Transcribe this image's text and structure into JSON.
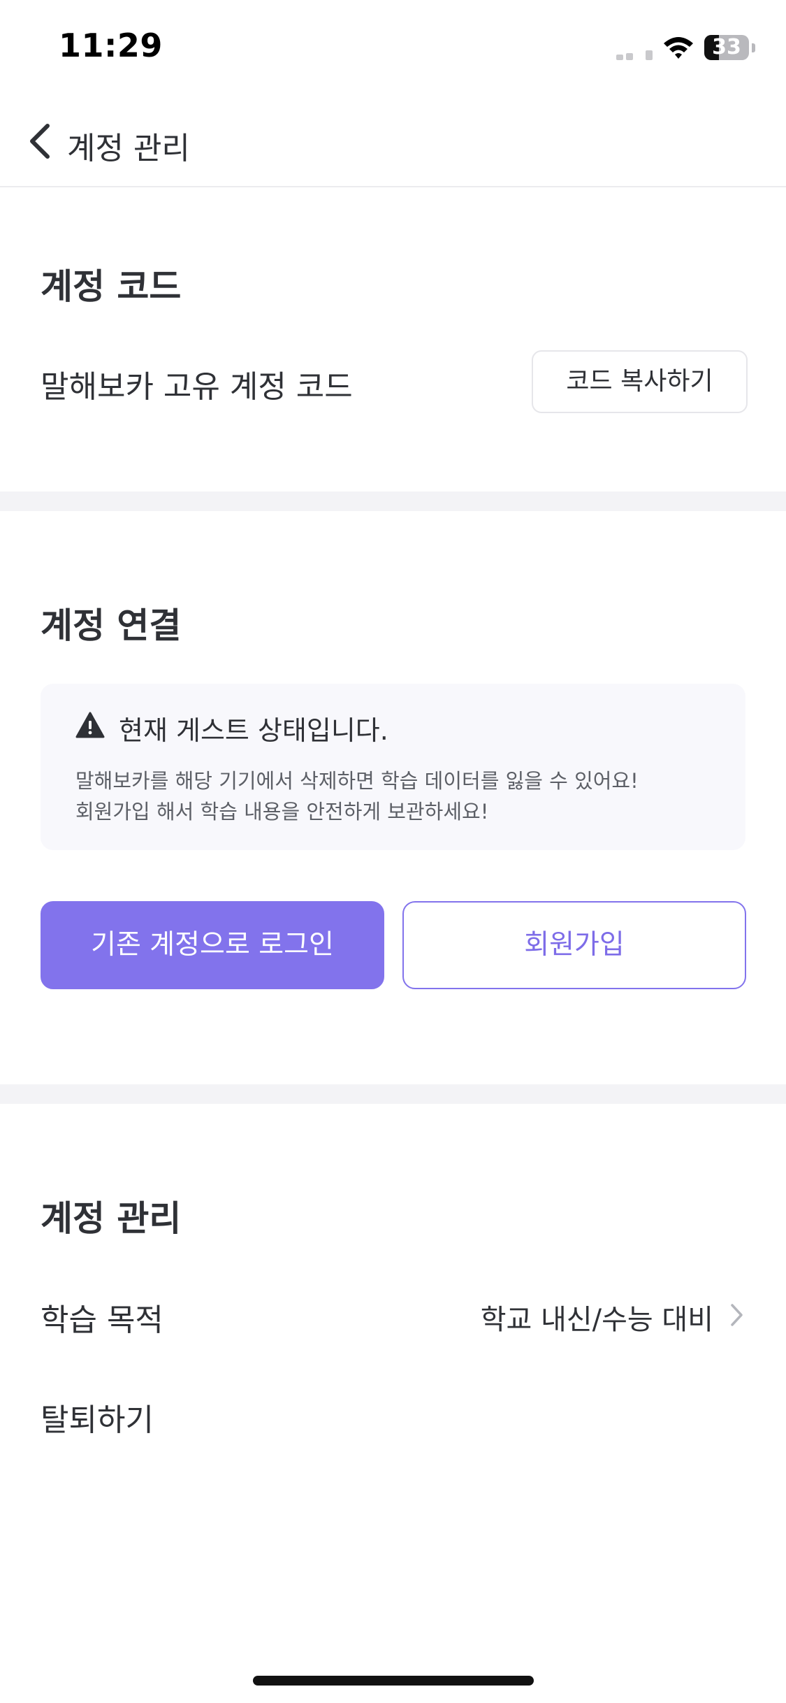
{
  "status_bar": {
    "time": "11:29",
    "battery_percent": "33",
    "battery_level": 0.33,
    "signal_icon": "cellular-signal-icon",
    "wifi_icon": "wifi-icon",
    "battery_icon": "battery-icon"
  },
  "header": {
    "title": "계정 관리",
    "back_icon": "chevron-left-icon"
  },
  "account_code": {
    "section_title": "계정 코드",
    "label": "말해보카 고유 계정 코드",
    "copy_button": "코드 복사하기"
  },
  "account_link": {
    "section_title": "계정 연결",
    "notice": {
      "icon": "warning-icon",
      "title": "현재 게스트 상태입니다.",
      "line1": "말해보카를 해당 기기에서 삭제하면 학습 데이터를 잃을 수 있어요!",
      "line2": "회원가입 해서 학습 내용을 안전하게 보관하세요!"
    },
    "login_button": "기존 계정으로 로그인",
    "signup_button": "회원가입"
  },
  "account_manage": {
    "section_title": "계정 관리",
    "study_goal_label": "학습 목적",
    "study_goal_value": "학교 내신/수능 대비",
    "chevron_icon": "chevron-right-icon",
    "withdraw_label": "탈퇴하기"
  },
  "colors": {
    "accent": "#8273EC",
    "divider": "#F3F3F6",
    "notice_bg": "#F8F8FC",
    "text_primary": "#2F3136",
    "text_secondary": "#5C5F66"
  }
}
